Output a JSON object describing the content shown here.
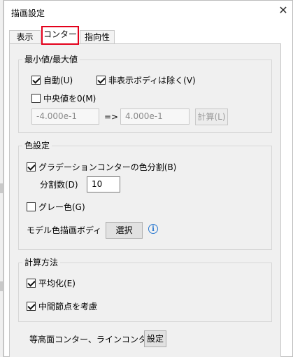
{
  "dialog": {
    "title": "描画設定",
    "close_glyph": "✕"
  },
  "tabs": [
    {
      "label": "表示",
      "active": false
    },
    {
      "label": "コンター",
      "active": true
    },
    {
      "label": "指向性",
      "active": false
    }
  ],
  "minmax": {
    "legend": "最小値/最大値",
    "auto": {
      "label": "自動(U)",
      "checked": true
    },
    "exclude_hidden": {
      "label": "非表示ボディは除く(V)",
      "checked": true
    },
    "center_zero": {
      "label": "中央値を0(M)",
      "checked": false
    },
    "min_value": "-4.000e-1",
    "arrow": "=>",
    "max_value": "4.000e-1",
    "calc_button": "計算(L)"
  },
  "color": {
    "legend": "色設定",
    "gradation": {
      "label": "グラデーションコンターの色分割(B)",
      "checked": true
    },
    "divisions_label": "分割数(D)",
    "divisions_value": "10",
    "grey": {
      "label": "グレー色(G)",
      "checked": false
    },
    "model_body_label": "モデル色描画ボディ",
    "select_button": "選択",
    "info_glyph": "i"
  },
  "calc": {
    "legend": "計算方法",
    "average": {
      "label": "平均化(E)",
      "checked": true
    },
    "mid_nodes": {
      "label": "中間節点を考慮",
      "checked": true
    }
  },
  "contour_lines": {
    "label": "等高面コンター、ラインコンター",
    "button": "設定"
  },
  "colors": {
    "tab_highlight": "#e3001b",
    "panel_bg": "#f0f0f0",
    "info_blue": "#2b79d0"
  }
}
